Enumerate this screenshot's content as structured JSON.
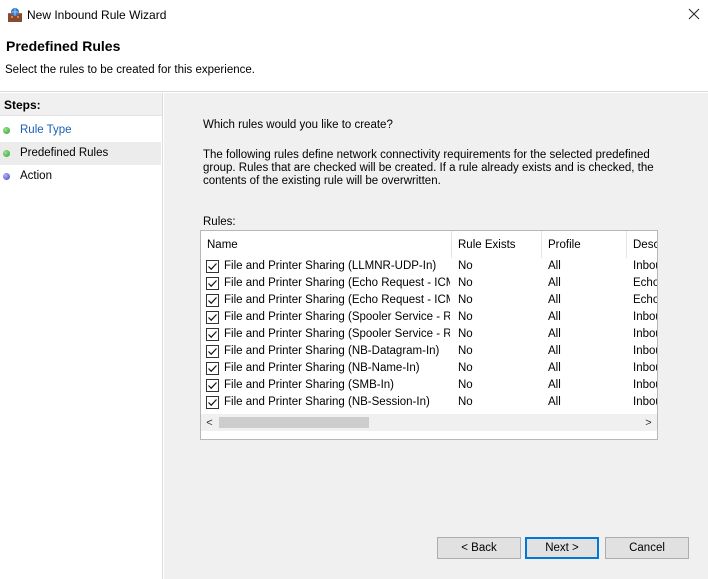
{
  "window": {
    "title": "New Inbound Rule Wizard",
    "close_icon": "close-icon"
  },
  "header": {
    "title": "Predefined Rules",
    "subtitle": "Select the rules to be created for this experience."
  },
  "steps": {
    "heading": "Steps:",
    "items": [
      {
        "label": "Rule Type",
        "status_color": "#4caf50",
        "is_link": true
      },
      {
        "label": "Predefined Rules",
        "status_color": "#4caf50",
        "current": true
      },
      {
        "label": "Action",
        "status_color": "#5b5bd6"
      }
    ]
  },
  "main": {
    "question": "Which rules would you like to create?",
    "description": "The following rules define network connectivity requirements for the selected predefined group. Rules that are checked will be created. If a rule already exists and is checked, the contents of the existing rule will be overwritten.",
    "rules_label": "Rules:",
    "columns": [
      "Name",
      "Rule Exists",
      "Profile",
      "Desc"
    ],
    "rows": [
      {
        "checked": true,
        "name": "File and Printer Sharing (LLMNR-UDP-In)",
        "exists": "No",
        "profile": "All",
        "desc": "Inbou"
      },
      {
        "checked": true,
        "name": "File and Printer Sharing (Echo Request - ICM...",
        "exists": "No",
        "profile": "All",
        "desc": "Echo"
      },
      {
        "checked": true,
        "name": "File and Printer Sharing (Echo Request - ICM...",
        "exists": "No",
        "profile": "All",
        "desc": "Echo"
      },
      {
        "checked": true,
        "name": "File and Printer Sharing (Spooler Service - RP...",
        "exists": "No",
        "profile": "All",
        "desc": "Inbou"
      },
      {
        "checked": true,
        "name": "File and Printer Sharing (Spooler Service - RPC)",
        "exists": "No",
        "profile": "All",
        "desc": "Inbou"
      },
      {
        "checked": true,
        "name": "File and Printer Sharing (NB-Datagram-In)",
        "exists": "No",
        "profile": "All",
        "desc": "Inbou"
      },
      {
        "checked": true,
        "name": "File and Printer Sharing (NB-Name-In)",
        "exists": "No",
        "profile": "All",
        "desc": "Inbou"
      },
      {
        "checked": true,
        "name": "File and Printer Sharing (SMB-In)",
        "exists": "No",
        "profile": "All",
        "desc": "Inbou"
      },
      {
        "checked": true,
        "name": "File and Printer Sharing (NB-Session-In)",
        "exists": "No",
        "profile": "All",
        "desc": "Inbou"
      }
    ],
    "scroll_left": "<",
    "scroll_right": ">"
  },
  "buttons": {
    "back": "< Back",
    "next": "Next >",
    "cancel": "Cancel"
  }
}
